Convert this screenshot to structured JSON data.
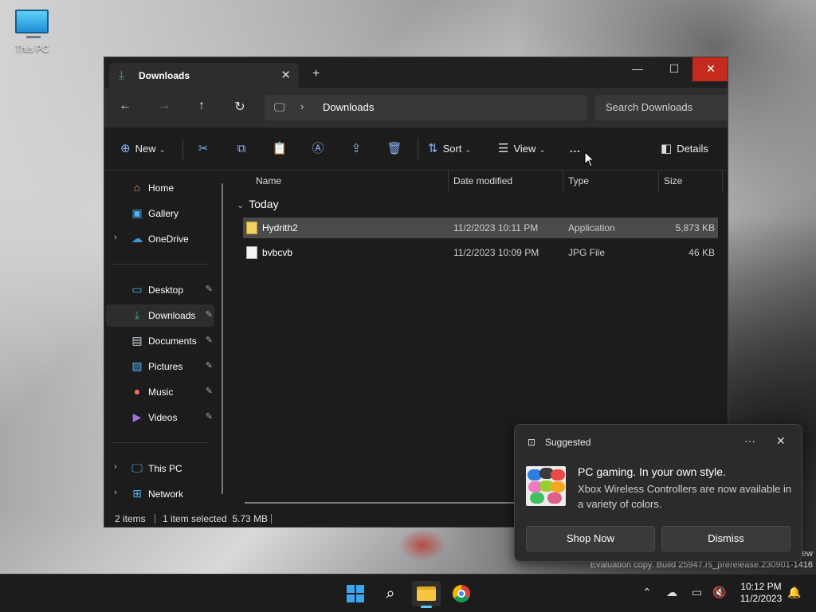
{
  "desktop": {
    "icon_label": "This PC",
    "watermark_line1": "ew",
    "watermark_line2": "Evaluation copy. Build 25947.rs_prerelease.230901-1416"
  },
  "window": {
    "tab_title": "Downloads",
    "address": {
      "crumb": "Downloads"
    },
    "search_placeholder": "Search Downloads",
    "toolbar": {
      "new_label": "New",
      "sort_label": "Sort",
      "view_label": "View",
      "more_label": "...",
      "details_label": "Details"
    },
    "nav": {
      "items": [
        {
          "label": "Home",
          "icon": "home-icon"
        },
        {
          "label": "Gallery",
          "icon": "gallery-icon"
        },
        {
          "label": "OneDrive",
          "icon": "onedrive-icon"
        },
        {
          "label": "Desktop",
          "icon": "desktop-icon"
        },
        {
          "label": "Downloads",
          "icon": "download-icon"
        },
        {
          "label": "Documents",
          "icon": "documents-icon"
        },
        {
          "label": "Pictures",
          "icon": "pictures-icon"
        },
        {
          "label": "Music",
          "icon": "music-icon"
        },
        {
          "label": "Videos",
          "icon": "videos-icon"
        },
        {
          "label": "This PC",
          "icon": "pc-icon"
        },
        {
          "label": "Network",
          "icon": "network-icon"
        }
      ]
    },
    "columns": {
      "name": "Name",
      "date": "Date modified",
      "type": "Type",
      "size": "Size"
    },
    "group_label": "Today",
    "files": [
      {
        "name": "Hydrith2",
        "date": "11/2/2023 10:11 PM",
        "type": "Application",
        "size": "5,873 KB",
        "selected": true
      },
      {
        "name": "bvbcvb",
        "date": "11/2/2023 10:09 PM",
        "type": "JPG File",
        "size": "46 KB",
        "selected": false
      }
    ],
    "status": {
      "count": "2 items",
      "selection": "1 item selected  5.73 MB"
    }
  },
  "toast": {
    "header": "Suggested",
    "title": "PC gaming. In your own style.",
    "body": "Xbox Wireless Controllers are now available in a variety of colors.",
    "primary_button": "Shop Now",
    "secondary_button": "Dismiss"
  },
  "taskbar": {
    "time": "10:12 PM",
    "date": "11/2/2023"
  },
  "colors": {
    "close_red": "#c42b1c",
    "accent_blue": "#60cdff",
    "download_green": "#3fb57d"
  }
}
